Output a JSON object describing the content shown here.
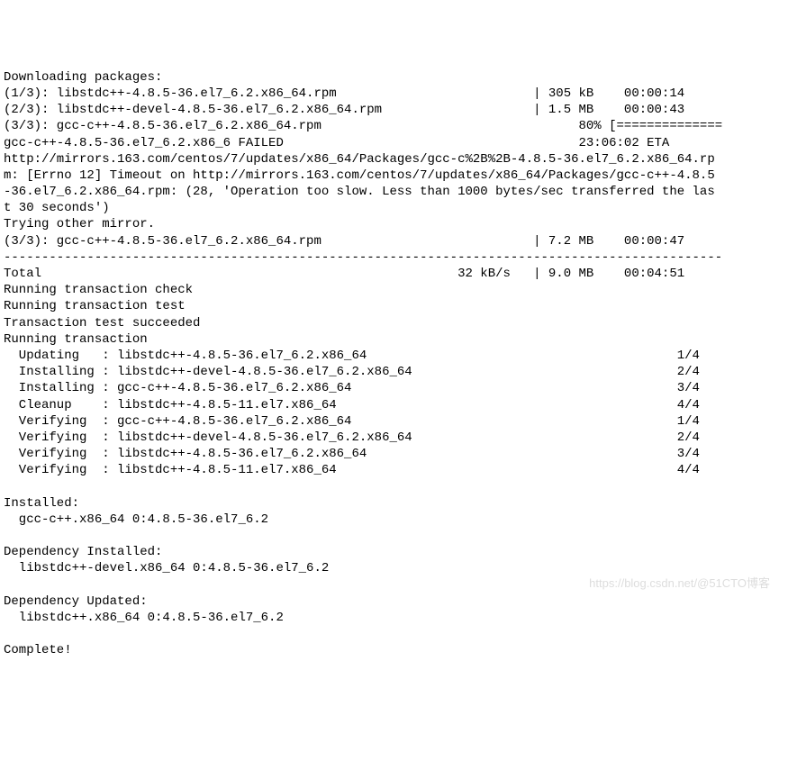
{
  "downloading_header": "Downloading packages:",
  "downloads": [
    {
      "idx": "(1/3):",
      "name": "libstdc++-4.8.5-36.el7_6.2.x86_64.rpm",
      "size": "| 305 kB",
      "time": "00:00:14"
    },
    {
      "idx": "(2/3):",
      "name": "libstdc++-devel-4.8.5-36.el7_6.2.x86_64.rpm",
      "size": "| 1.5 MB",
      "time": "00:00:43"
    }
  ],
  "partial": {
    "idx": "(3/3):",
    "name": "gcc-c++-4.8.5-36.el7_6.2.x86_64.rpm",
    "percent": "80%",
    "bar": "[=============="
  },
  "fail_line": "gcc-c++-4.8.5-36.el7_6.2.x86_6 FAILED",
  "eta": "23:06:02 ETA",
  "error_text": "http://mirrors.163.com/centos/7/updates/x86_64/Packages/gcc-c%2B%2B-4.8.5-36.el7_6.2.x86_64.rp\nm: [Errno 12] Timeout on http://mirrors.163.com/centos/7/updates/x86_64/Packages/gcc-c++-4.8.5\n-36.el7_6.2.x86_64.rpm: (28, 'Operation too slow. Less than 1000 bytes/sec transferred the las\nt 30 seconds')",
  "trying": "Trying other mirror.",
  "retry": {
    "idx": "(3/3):",
    "name": "gcc-c++-4.8.5-36.el7_6.2.x86_64.rpm",
    "size": "| 7.2 MB",
    "time": "00:00:47"
  },
  "divider": "-----------------------------------------------------------------------------------------------",
  "total": {
    "label": "Total",
    "rate": "32 kB/s",
    "size": "| 9.0 MB",
    "time": "00:04:51"
  },
  "trans_check": "Running transaction check",
  "trans_test": "Running transaction test",
  "trans_ok": "Transaction test succeeded",
  "trans_run": "Running transaction",
  "ops": [
    {
      "action": "Updating  ",
      "pkg": "libstdc++-4.8.5-36.el7_6.2.x86_64",
      "count": "1/4"
    },
    {
      "action": "Installing",
      "pkg": "libstdc++-devel-4.8.5-36.el7_6.2.x86_64",
      "count": "2/4"
    },
    {
      "action": "Installing",
      "pkg": "gcc-c++-4.8.5-36.el7_6.2.x86_64",
      "count": "3/4"
    },
    {
      "action": "Cleanup   ",
      "pkg": "libstdc++-4.8.5-11.el7.x86_64",
      "count": "4/4"
    },
    {
      "action": "Verifying ",
      "pkg": "gcc-c++-4.8.5-36.el7_6.2.x86_64",
      "count": "1/4"
    },
    {
      "action": "Verifying ",
      "pkg": "libstdc++-devel-4.8.5-36.el7_6.2.x86_64",
      "count": "2/4"
    },
    {
      "action": "Verifying ",
      "pkg": "libstdc++-4.8.5-36.el7_6.2.x86_64",
      "count": "3/4"
    },
    {
      "action": "Verifying ",
      "pkg": "libstdc++-4.8.5-11.el7.x86_64",
      "count": "4/4"
    }
  ],
  "installed_header": "Installed:",
  "installed_pkg": "  gcc-c++.x86_64 0:4.8.5-36.el7_6.2",
  "dep_installed_header": "Dependency Installed:",
  "dep_installed_pkg": "  libstdc++-devel.x86_64 0:4.8.5-36.el7_6.2",
  "dep_updated_header": "Dependency Updated:",
  "dep_updated_pkg": "  libstdc++.x86_64 0:4.8.5-36.el7_6.2",
  "complete": "Complete!",
  "watermark": "https://blog.csdn.net/@51CTO博客"
}
